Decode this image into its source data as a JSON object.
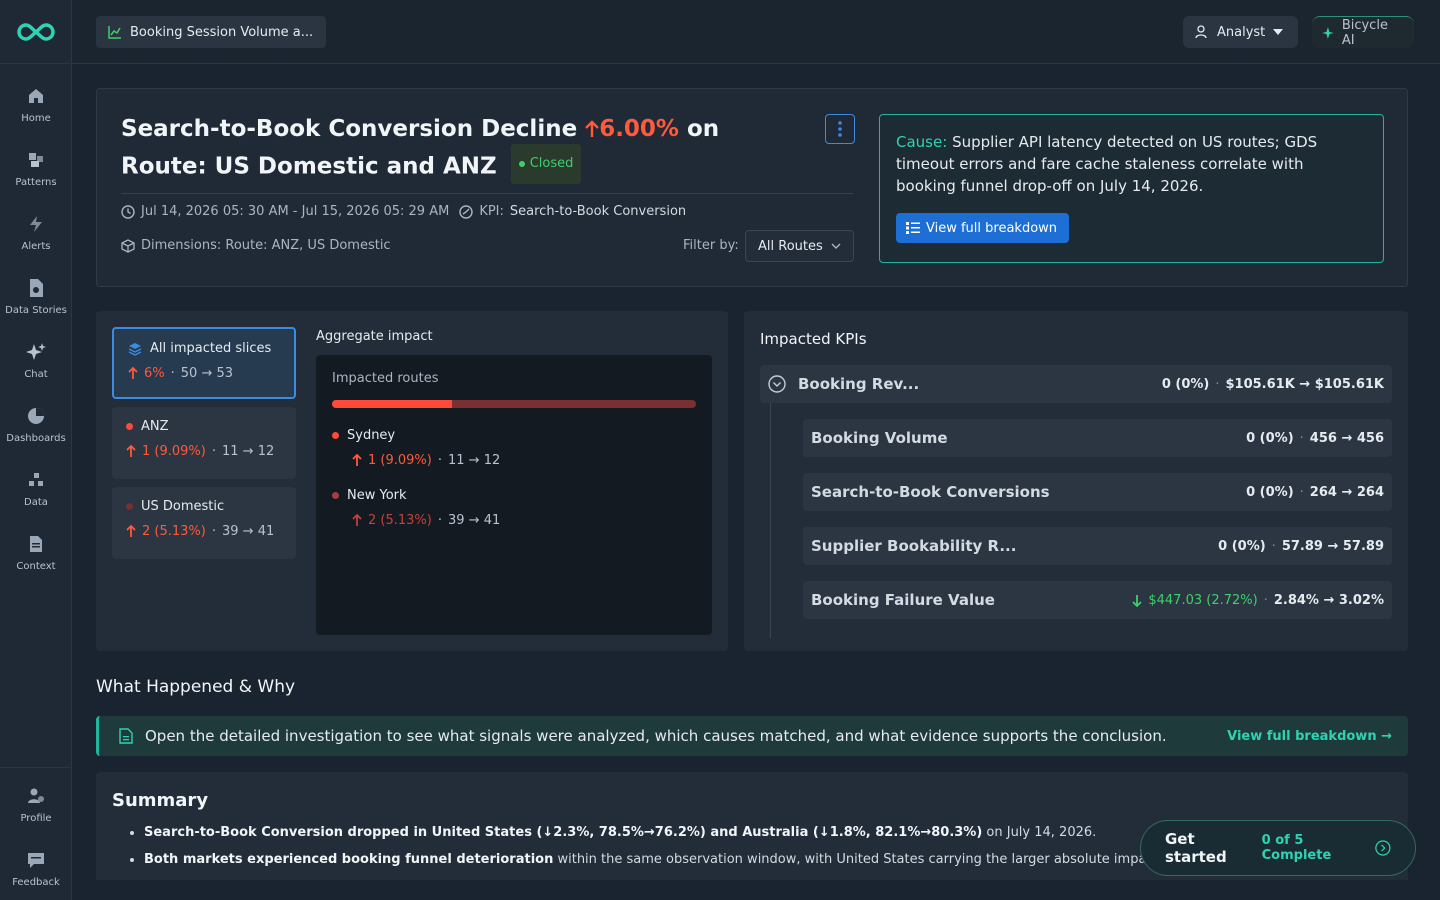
{
  "sidebar": {
    "items": [
      {
        "label": "Home",
        "icon": "home-icon"
      },
      {
        "label": "Patterns",
        "icon": "patterns-icon"
      },
      {
        "label": "Alerts",
        "icon": "bolt-icon"
      },
      {
        "label": "Data Stories",
        "icon": "document-icon"
      },
      {
        "label": "Chat",
        "icon": "sparkle-icon"
      },
      {
        "label": "Dashboards",
        "icon": "pie-icon"
      },
      {
        "label": "Data",
        "icon": "data-icon"
      },
      {
        "label": "Context",
        "icon": "context-icon"
      }
    ],
    "bottom": [
      {
        "label": "Profile",
        "icon": "profile-icon"
      },
      {
        "label": "Feedback",
        "icon": "feedback-icon"
      }
    ]
  },
  "topbar": {
    "title": "Booking Session Volume a...",
    "role": "Analyst",
    "ai_label": "Bicycle AI"
  },
  "header": {
    "title_prefix": "Search-to-Book Conversion Decline ",
    "title_change": "6.00%",
    "title_suffix": " on Route: US Domestic and ANZ",
    "status": "Closed",
    "time_range": "Jul 14, 2026 05: 30 AM - Jul 15, 2026 05: 29 AM",
    "kpi_label": "KPI:",
    "kpi_value": "Search-to-Book Conversion",
    "dimensions": "Dimensions: Route: ANZ, US Domestic",
    "filter_label": "Filter by:",
    "filter_value": "All Routes",
    "cause_label": "Cause:",
    "cause_text": "Supplier API latency detected on US routes; GDS timeout errors and fare cache staleness correlate with booking funnel drop-off on July 14, 2026.",
    "breakdown_button": "View full breakdown"
  },
  "slices": {
    "all": {
      "name": "All impacted slices",
      "change": "6%",
      "range": "50 → 53"
    },
    "items": [
      {
        "name": "ANZ",
        "change": "1 (9.09%)",
        "range": "11 → 12",
        "color": "#ff4a3a"
      },
      {
        "name": "US Domestic",
        "change": "2 (5.13%)",
        "range": "39 → 41",
        "color": "#7a2f33"
      }
    ]
  },
  "aggregate": {
    "title": "Aggregate impact",
    "box_title": "Impacted routes",
    "bar_fraction": 0.33,
    "items": [
      {
        "name": "Sydney",
        "change": "1 (9.09%)",
        "range": "11 → 12",
        "color": "#ff4a3a"
      },
      {
        "name": "New York",
        "change": "2 (5.13%)",
        "range": "39 → 41",
        "color": "#a04040"
      }
    ]
  },
  "kpis": {
    "title": "Impacted KPIs",
    "parent": {
      "name": "Booking Rev...",
      "delta": "0 (0%)",
      "range": "$105.61K → $105.61K"
    },
    "children": [
      {
        "name": "Booking Volume",
        "delta": "0 (0%)",
        "range": "456 → 456"
      },
      {
        "name": "Search-to-Book Conversions",
        "delta": "0 (0%)",
        "range": "264 → 264"
      },
      {
        "name": "Supplier Bookability R...",
        "delta": "0 (0%)",
        "range": "57.89 → 57.89"
      },
      {
        "name": "Booking Failure Value",
        "delta": "$447.03 (2.72%)",
        "range": "2.84% → 3.02%"
      }
    ]
  },
  "what_happened": {
    "title": "What Happened & Why",
    "banner_text": "Open the detailed investigation to see what signals were analyzed, which causes matched, and what evidence supports the conclusion.",
    "banner_link": "View full breakdown →"
  },
  "summary": {
    "title": "Summary",
    "bullet1_bold": "Search-to-Book Conversion dropped in United States (↓2.3%, 78.5%→76.2%) and Australia (↓1.8%, 82.1%→80.3%)",
    "bullet1_rest": " on July 14, 2026.",
    "bullet2_bold": "Both markets experienced booking funnel deterioration",
    "bullet2_rest": " within the same observation window, with United States carrying the larger absolute impact."
  },
  "get_started": {
    "label": "Get started",
    "progress": "0 of 5 Complete"
  },
  "colors": {
    "accent": "#3b8be0",
    "teal": "#1fb59a",
    "negative": "#ff5a3c",
    "positive": "#3ecf6b"
  }
}
